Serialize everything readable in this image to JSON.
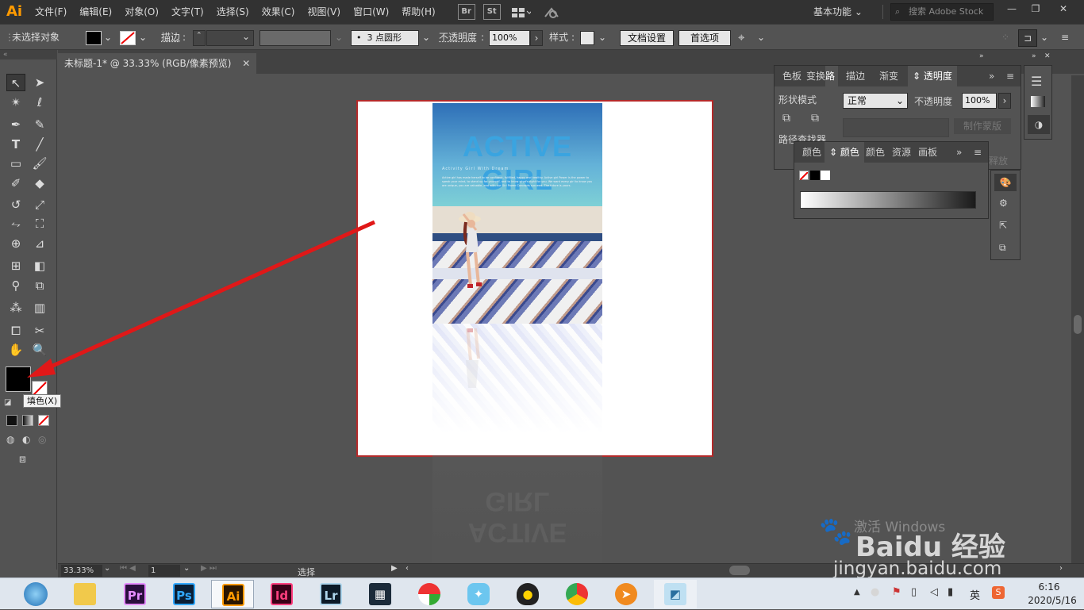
{
  "menubar": {
    "logo": "Ai",
    "items": [
      "文件(F)",
      "编辑(E)",
      "对象(O)",
      "文字(T)",
      "选择(S)",
      "效果(C)",
      "视图(V)",
      "窗口(W)",
      "帮助(H)"
    ],
    "br_label": "Br",
    "st_label": "St",
    "workspace": "基本功能",
    "search_placeholder": "搜索 Adobe Stock"
  },
  "controlbar": {
    "selection_status": "未选择对象",
    "stroke_label": "描边",
    "brush_value": "3 点圆形",
    "opacity_label": "不透明度",
    "opacity_value": "100%",
    "style_label": "样式",
    "doc_setup_btn": "文档设置",
    "prefs_btn": "首选项"
  },
  "document": {
    "tab_title": "未标题-1* @ 33.33% (RGB/像素预览)"
  },
  "tooltip": "填色(X)",
  "poster": {
    "title": "ACTIVE GIRL",
    "subtitle": "Activity Girl With Dream",
    "body": "Active girl has made herself to be confident, fulfilled, happy and healthy. Active girl Power is the power to speak your mind, to stand up for yourself, and to know what's right for you. We want every girl to know you are unique, you are valuable, and with our Girl Power Concepts succeed. The future is yours.",
    "ghost_title": "ACTIVE GIRL"
  },
  "transparency_panel": {
    "tabs": [
      "色板",
      "变换",
      "路",
      "描边",
      "渐变",
      "透明度"
    ],
    "blend_mode": "正常",
    "opacity_label": "不透明度",
    "opacity_value": "100%",
    "shape_mode_label": "形状模式",
    "pathfinder_label": "路径查找器",
    "make_mask_btn": "制作蒙版",
    "release_btn": "释放"
  },
  "color_panel": {
    "tabs": [
      "颜色",
      "颜色",
      "颜色",
      "资源",
      "画板"
    ]
  },
  "statusbar": {
    "zoom": "33.33%",
    "page": "1",
    "mode": "选择"
  },
  "taskbar": {
    "apps": [
      "ie",
      "explorer",
      "Pr",
      "Ps",
      "Ai",
      "Id",
      "Lr",
      "media",
      "umbrella",
      "bird",
      "qq",
      "chrome",
      "fox",
      "notepad"
    ],
    "time": "6:16",
    "date": "2020/5/16",
    "ime": "英"
  },
  "watermark": {
    "activate": "激活 Windows",
    "brand": "Baidu 经验",
    "site": "jingyan.baidu.com"
  },
  "colors": {
    "ui_dark": "#323232",
    "ui_mid": "#535353",
    "artboard_border": "#b42a2a",
    "arrow": "#e01818",
    "poster_title": "#3aa4e0"
  }
}
